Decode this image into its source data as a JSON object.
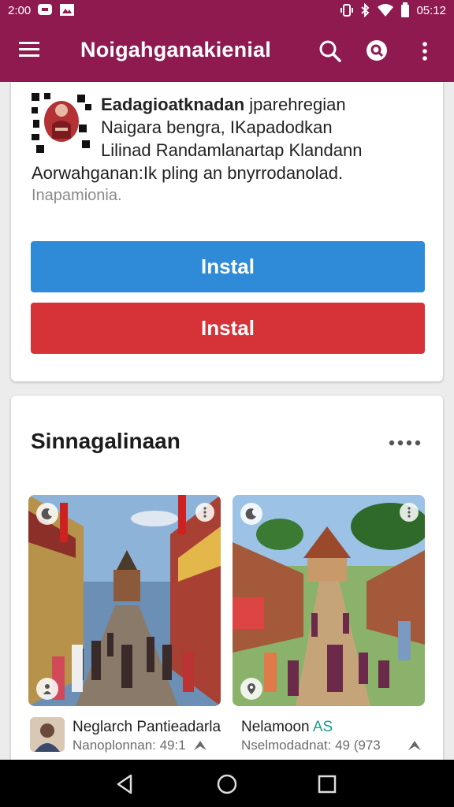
{
  "status_bar": {
    "left_text": "2:00",
    "time": "05:12",
    "icons": [
      "message-icon",
      "image-icon",
      "vibrate-icon",
      "bluetooth-icon",
      "wifi-icon",
      "battery-icon"
    ]
  },
  "app_bar": {
    "title": "Noigahganakienial",
    "menu_icon": "hamburger-menu-icon",
    "actions": [
      "search-icon",
      "search-filled-icon",
      "overflow-menu-icon"
    ]
  },
  "app_card": {
    "title": "Eadagioatknadan",
    "line1_rest": "jparehregian",
    "line2": "Naigara bengra, IKapadodkan",
    "line3": "Lilinad Randamlanartap Klandann",
    "line4": "Aorwahganan:Ik pling an bnyrrodanolad.",
    "line5": "Inapamionia.",
    "primary_button": "Instal",
    "secondary_button": "Instal"
  },
  "section": {
    "title": "Sinnagalinaan",
    "more_icon": "more-horizontal-icon"
  },
  "items": [
    {
      "title": "Neglarch Pantieadarla",
      "subtitle": "Nanoplonnan: 49:1",
      "badge_icon": "moon-icon",
      "corner_icon": "more-vertical-icon",
      "bottom_icon": "person-icon"
    },
    {
      "title": "Nelamoon",
      "title_accent": "AS",
      "subtitle": "Nselmodadnat: 49 (973",
      "badge_icon": "moon-icon",
      "corner_icon": "more-vertical-icon",
      "bottom_icon": "location-icon"
    }
  ],
  "nav_bar": {
    "buttons": [
      "back-icon",
      "home-icon",
      "recents-icon"
    ]
  },
  "colors": {
    "brand": "#8e1a4f",
    "primary_button": "#2f8bd8",
    "secondary_button": "#d53338",
    "accent_text": "#1aa089"
  }
}
